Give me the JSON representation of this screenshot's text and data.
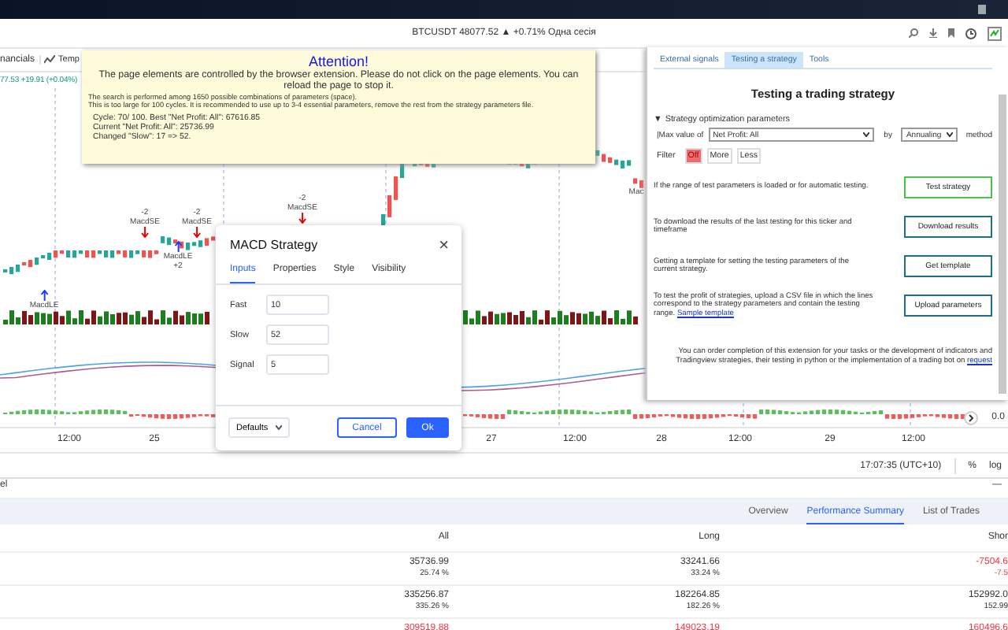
{
  "browser": {
    "ticker": "BTCUSDT 48077.52 ▲ +0.71% Одна сесія"
  },
  "chart": {
    "toolbar": [
      "nancials",
      "Temp"
    ],
    "legend": "77.53 +19.91 (+0.04%)",
    "markers": [
      {
        "kind": "short",
        "lines": [
          "-2",
          "MacdSE"
        ]
      },
      {
        "kind": "short",
        "lines": [
          "-2",
          "MacdSE"
        ]
      },
      {
        "kind": "short",
        "lines": [
          "-2",
          "MacdSE"
        ]
      },
      {
        "kind": "long",
        "lines": [
          "MacdLE",
          "+2"
        ]
      },
      {
        "kind": "long",
        "lines": [
          "MacdLE"
        ]
      },
      {
        "kind": "label",
        "lines": [
          "Mac"
        ]
      }
    ],
    "price_label": "0.0",
    "time_axis": [
      "12:00",
      "25",
      "27",
      "12:00",
      "28",
      "12:00",
      "29",
      "12:00"
    ],
    "status": {
      "time": "17:07:35 (UTC+10)",
      "percent": "%",
      "log": "log"
    }
  },
  "attention": {
    "title": "Attention!",
    "message": "The page elements are controlled by the browser extension. Please do not click on the page elements. You can reload the page to stop it.",
    "notes": [
      "The search is performed among 1650 possible combinations of parameters (space).",
      "This is too large for 100 cycles. It is recommended to use up to 3-4 essential parameters, remove the rest from the strategy parameters file."
    ],
    "progress": [
      "Cycle: 70/ 100. Best \"Net Profit: All\": 67616.85",
      "Current \"Net Profit: All\": 25736.99",
      "Changed \"Slow\": 17 => 52."
    ]
  },
  "extension_panel": {
    "tabs": [
      {
        "label": "External signals",
        "selected": false
      },
      {
        "label": "Testing a strategy",
        "selected": true
      },
      {
        "label": "Tools",
        "selected": false
      }
    ],
    "heading": "Testing a trading strategy",
    "section": {
      "toggle": "▼",
      "title": "Strategy optimization parameters"
    },
    "criterion": {
      "label": "|Max value of",
      "metric": "Net Profit: All",
      "by": "by",
      "period": "Annualing",
      "method": "method"
    },
    "filter": {
      "label": "Filter",
      "options": [
        {
          "label": "Off",
          "selected": true
        },
        {
          "label": "More",
          "selected": false
        },
        {
          "label": "Less",
          "selected": false
        }
      ]
    },
    "actions": [
      {
        "text": "If the range of test parameters is loaded or for automatic testing.",
        "button": "Test strategy",
        "highlighted": true
      },
      {
        "text": "To download the results of the last testing for this ticker and timeframe",
        "button": "Download results",
        "highlighted": false
      },
      {
        "text": "Getting a template for setting the testing parameters of the current strategy.",
        "button": "Get template",
        "highlighted": false
      },
      {
        "text": "To test the profit of strategies, upload a CSV file in which the lines correspond to the strategy parameters and contain the testing range.",
        "link": "Sample template",
        "button": "Upload parameters",
        "highlighted": false
      }
    ],
    "footer": {
      "text": "You can order completion of this extension for your tasks or the development of indicators and Tradingview strategies, their testing in python or the implementation of a trading bot on",
      "link": "request"
    }
  },
  "dialog": {
    "title": "MACD Strategy",
    "close": "×",
    "tabs": [
      {
        "label": "Inputs",
        "selected": true
      },
      {
        "label": "Properties",
        "selected": false
      },
      {
        "label": "Style",
        "selected": false
      },
      {
        "label": "Visibility",
        "selected": false
      }
    ],
    "fields": [
      {
        "label": "Fast",
        "value": "10"
      },
      {
        "label": "Slow",
        "value": "52"
      },
      {
        "label": "Signal",
        "value": "5"
      }
    ],
    "defaults": "Defaults",
    "cancel": "Cancel",
    "ok": "Ok"
  },
  "tester": {
    "title": "el",
    "minimize": "—",
    "tabs": [
      {
        "label": "Overview",
        "selected": false
      },
      {
        "label": "Performance Summary",
        "selected": true
      },
      {
        "label": "List of Trades",
        "selected": false
      }
    ],
    "columns": [
      "All",
      "Long",
      "Shor"
    ],
    "rows": [
      {
        "cells": [
          {
            "value": "35736.99",
            "sub": "25.74 %",
            "negative": false
          },
          {
            "value": "33241.66",
            "sub": "33.24 %",
            "negative": false
          },
          {
            "value": "-7504.6",
            "sub": "-7.5",
            "negative": true
          }
        ]
      },
      {
        "cells": [
          {
            "value": "335256.87",
            "sub": "335.26 %",
            "negative": false
          },
          {
            "value": "182264.85",
            "sub": "182.26 %",
            "negative": false
          },
          {
            "value": "152992.0",
            "sub": "152.99",
            "negative": false
          }
        ]
      },
      {
        "cells": [
          {
            "value": "309519.88",
            "negative": true
          },
          {
            "value": "149023.19",
            "negative": true
          },
          {
            "value": "160496.6",
            "negative": true
          }
        ]
      }
    ]
  }
}
